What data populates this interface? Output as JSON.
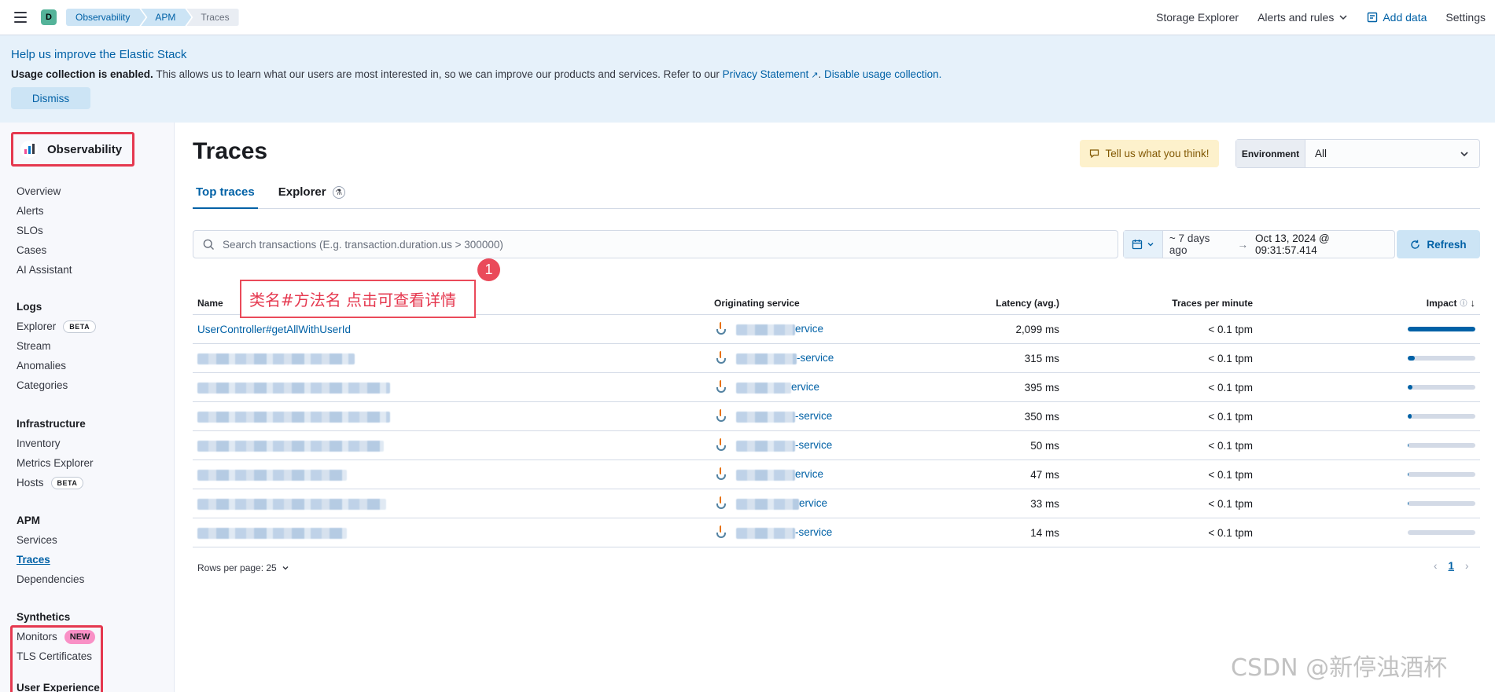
{
  "header": {
    "space_initial": "D",
    "breadcrumbs": [
      "Observability",
      "APM",
      "Traces"
    ],
    "links": {
      "storage_explorer": "Storage Explorer",
      "alerts_rules": "Alerts and rules",
      "add_data": "Add data",
      "settings": "Settings"
    }
  },
  "callout": {
    "title": "Help us improve the Elastic Stack",
    "bold": "Usage collection is enabled.",
    "body": " This allows us to learn what our users are most interested in, so we can improve our products and services. Refer to our ",
    "privacy_link": "Privacy Statement",
    "disable_link": "Disable usage collection.",
    "dismiss": "Dismiss"
  },
  "sidebar": {
    "brand": "Observability",
    "top_items": [
      "Overview",
      "Alerts",
      "SLOs",
      "Cases",
      "AI Assistant"
    ],
    "logs": {
      "heading": "Logs",
      "explorer": "Explorer",
      "explorer_badge": "BETA",
      "stream": "Stream",
      "anomalies": "Anomalies",
      "categories": "Categories"
    },
    "infra": {
      "heading": "Infrastructure",
      "inventory": "Inventory",
      "metrics": "Metrics Explorer",
      "hosts": "Hosts",
      "hosts_badge": "BETA"
    },
    "apm": {
      "heading": "APM",
      "services": "Services",
      "traces": "Traces",
      "dependencies": "Dependencies"
    },
    "synthetics": {
      "heading": "Synthetics",
      "monitors": "Monitors",
      "monitors_badge": "NEW",
      "tls": "TLS Certificates"
    },
    "ux": {
      "heading": "User Experience"
    }
  },
  "main": {
    "title": "Traces",
    "feedback": "Tell us what you think!",
    "environment": {
      "label": "Environment",
      "value": "All"
    },
    "tabs": [
      "Top traces",
      "Explorer"
    ],
    "search": {
      "placeholder": "Search transactions (E.g. transaction.duration.us > 300000)"
    },
    "date": {
      "start": "~ 7 days ago",
      "end": "Oct 13, 2024 @ 09:31:57.414"
    },
    "refresh": "Refresh",
    "annotation": {
      "number": "1",
      "text": "类名#方法名  点击可查看详情"
    },
    "table": {
      "headers": {
        "name": "Name",
        "service": "Originating service",
        "latency": "Latency (avg.)",
        "tpm": "Traces per minute",
        "impact": "Impact"
      },
      "rows": [
        {
          "name": "UserController#getAllWithUserId",
          "service_suffix": "ervice",
          "latency": "2,099 ms",
          "tpm": "< 0.1 tpm",
          "impact": 1.0
        },
        {
          "name": "",
          "service_suffix": "-service",
          "latency": "315 ms",
          "tpm": "< 0.1 tpm",
          "impact": 0.1
        },
        {
          "name": "",
          "service_suffix": "ervice",
          "latency": "395 ms",
          "tpm": "< 0.1 tpm",
          "impact": 0.07
        },
        {
          "name": "",
          "service_suffix": "-service",
          "latency": "350 ms",
          "tpm": "< 0.1 tpm",
          "impact": 0.06
        },
        {
          "name": "",
          "service_suffix": "-service",
          "latency": "50 ms",
          "tpm": "< 0.1 tpm",
          "impact": 0.01
        },
        {
          "name": "",
          "service_suffix": "ervice",
          "latency": "47 ms",
          "tpm": "< 0.1 tpm",
          "impact": 0.01
        },
        {
          "name": "",
          "service_suffix": "ervice",
          "latency": "33 ms",
          "tpm": "< 0.1 tpm",
          "impact": 0.01
        },
        {
          "name": "",
          "service_suffix": "-service",
          "latency": "14 ms",
          "tpm": "< 0.1 tpm",
          "impact": 0.0
        }
      ]
    },
    "rows_per_page": "Rows per page: 25",
    "page": "1"
  },
  "watermark": "CSDN @新停浊酒杯"
}
